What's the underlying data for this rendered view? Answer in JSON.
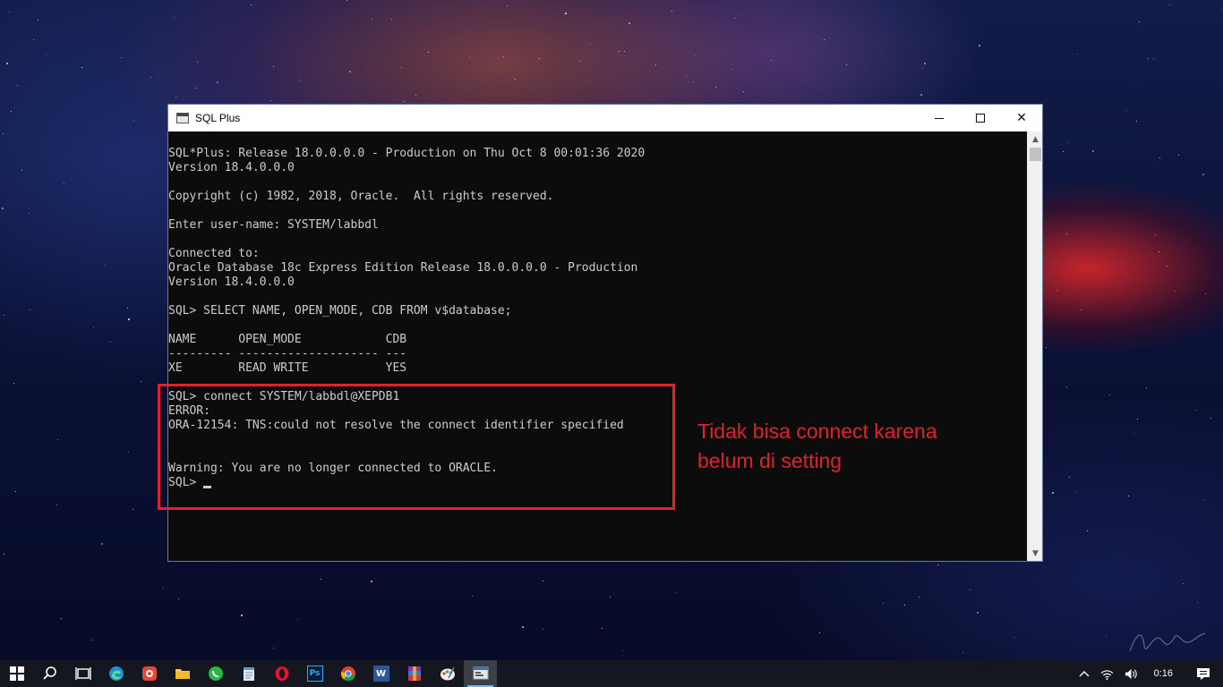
{
  "window": {
    "title": "SQL Plus",
    "controls": {
      "minimize": "",
      "maximize": "",
      "close": "✕"
    }
  },
  "console": {
    "lines": [
      "SQL*Plus: Release 18.0.0.0.0 - Production on Thu Oct 8 00:01:36 2020",
      "Version 18.4.0.0.0",
      "",
      "Copyright (c) 1982, 2018, Oracle.  All rights reserved.",
      "",
      "Enter user-name: SYSTEM/labbdl",
      "",
      "Connected to:",
      "Oracle Database 18c Express Edition Release 18.0.0.0.0 - Production",
      "Version 18.4.0.0.0",
      "",
      "SQL> SELECT NAME, OPEN_MODE, CDB FROM v$database;",
      "",
      "NAME      OPEN_MODE            CDB",
      "--------- -------------------- ---",
      "XE        READ WRITE           YES",
      "",
      "SQL> connect SYSTEM/labbdl@XEPDB1",
      "ERROR:",
      "ORA-12154: TNS:could not resolve the connect identifier specified",
      "",
      "",
      "Warning: You are no longer connected to ORACLE.",
      "SQL> "
    ]
  },
  "annotation": {
    "line1": "Tidak bisa connect karena",
    "line2": "belum di setting",
    "color": "#e0222b"
  },
  "taskbar": {
    "items": [
      {
        "name": "windows-start-icon"
      },
      {
        "name": "search-icon"
      },
      {
        "name": "task-view-icon"
      },
      {
        "name": "edge-icon"
      },
      {
        "name": "screen-recorder-icon"
      },
      {
        "name": "file-explorer-icon"
      },
      {
        "name": "whatsapp-icon"
      },
      {
        "name": "notepad-icon"
      },
      {
        "name": "opera-icon"
      },
      {
        "name": "photoshop-icon",
        "label": "Ps"
      },
      {
        "name": "chrome-icon"
      },
      {
        "name": "word-icon",
        "label": "W"
      },
      {
        "name": "winrar-icon"
      },
      {
        "name": "paint-icon"
      },
      {
        "name": "sqlplus-taskbar-icon"
      }
    ],
    "clock": "0:16"
  },
  "colors": {
    "console_bg": "#0c0c0c",
    "console_text": "#cccccc",
    "taskbar_bg": "#14171f"
  }
}
